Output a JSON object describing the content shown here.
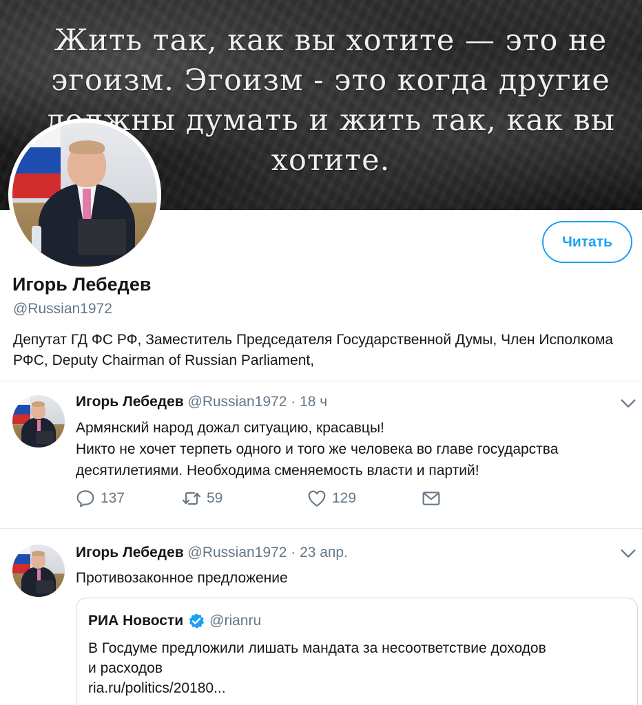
{
  "banner": {
    "quote_lines": [
      "Жить так, как вы хотите — это не",
      "эгоизм. Эгоизм - это когда другие",
      "должны думать и жить так, как вы",
      "хотите."
    ]
  },
  "profile": {
    "name": "Игорь Лебедев",
    "handle": "@Russian1972",
    "bio": "Депутат ГД ФС РФ, Заместитель Председателя Государственной Думы, Член Исполкома РФС, Deputy Chairman of Russian Parliament,",
    "follow_label": "Читать"
  },
  "tweets": [
    {
      "name": "Игорь Лебедев",
      "handle": "@Russian1972",
      "sep": "·",
      "time": "18 ч",
      "lines": [
        "Армянский народ дожал ситуацию, красавцы!",
        "Никто не хочет терпеть одного и того же человека во главе государства",
        "десятилетиями. Необходима сменяемость власти и партий!"
      ],
      "replies": "137",
      "retweets": "59",
      "likes": "129"
    },
    {
      "name": "Игорь Лебедев",
      "handle": "@Russian1972",
      "sep": "·",
      "time": "23 апр.",
      "text": "Противозаконное предложение",
      "quoted": {
        "name": "РИА Новости",
        "handle": "@rianru",
        "lines": [
          "В Госдуме предложили лишать мандата за несоответствие доходов",
          "и расходов",
          "ria.ru/politics/20180..."
        ]
      }
    }
  ],
  "colors": {
    "accent": "#1da1f2",
    "muted": "#657786",
    "text": "#14171a",
    "divider": "#e1e8ed"
  },
  "icons": {
    "reply": "reply-icon",
    "retweet": "retweet-icon",
    "like": "heart-icon",
    "message": "envelope-icon",
    "more": "chevron-down-icon",
    "verified": "verified-badge-icon"
  }
}
